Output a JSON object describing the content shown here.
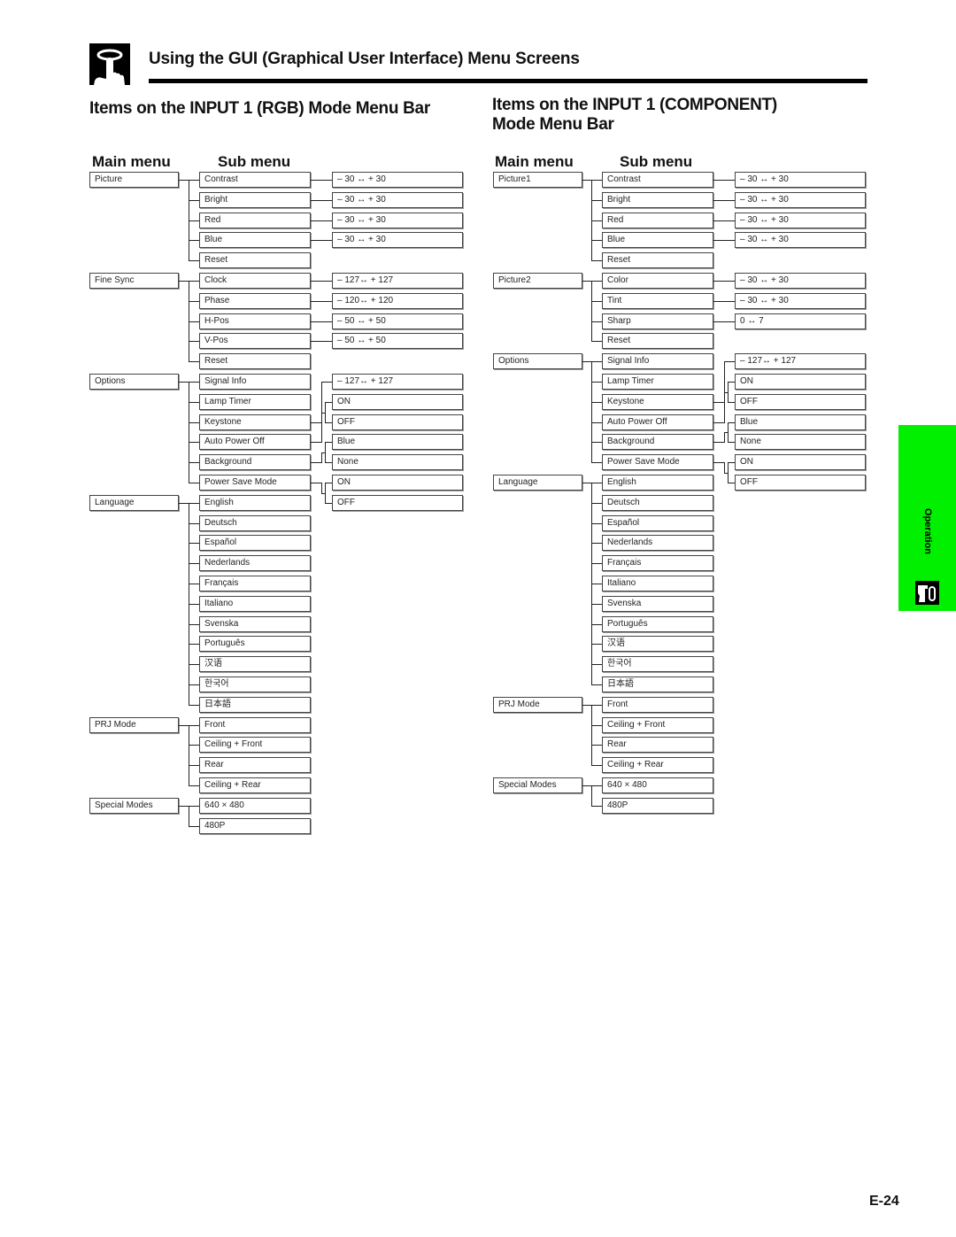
{
  "header": {
    "icon": "pointing-hand-icon",
    "title": "Using the GUI (Graphical User Interface) Menu Screens"
  },
  "rgb": {
    "heading": "Items on the INPUT 1 (RGB) Mode Menu Bar",
    "main_menu_label": "Main menu",
    "sub_menu_label": "Sub menu",
    "groups": [
      {
        "main": "Picture",
        "row": 0,
        "subs": [
          "Contrast",
          "Bright",
          "Red",
          "Blue",
          "Reset"
        ]
      },
      {
        "main": "Fine Sync",
        "row": 5,
        "subs": [
          "Clock",
          "Phase",
          "H-Pos",
          "V-Pos",
          "Reset"
        ]
      },
      {
        "main": "Options",
        "row": 10,
        "subs": [
          "Signal Info",
          "Lamp Timer",
          "Keystone",
          "Auto Power Off",
          "Background",
          "Power Save Mode"
        ]
      },
      {
        "main": "Language",
        "row": 16,
        "subs": [
          "English",
          "Deutsch",
          "Español",
          "Nederlands",
          "Français",
          "Italiano",
          "Svenska",
          "Português",
          "汉语",
          "한국어",
          "日本語"
        ]
      },
      {
        "main": "PRJ Mode",
        "row": 27,
        "subs": [
          "Front",
          "Ceiling + Front",
          "Rear",
          "Ceiling + Rear"
        ]
      },
      {
        "main": "Special Modes",
        "row": 31,
        "subs": [
          "640 × 480",
          "480P"
        ]
      }
    ],
    "values": [
      {
        "row": 0,
        "text": "– 30 ↔ + 30",
        "from_row": 0
      },
      {
        "row": 1,
        "text": "– 30 ↔ + 30",
        "from_row": 1
      },
      {
        "row": 2,
        "text": "– 30 ↔ + 30",
        "from_row": 2
      },
      {
        "row": 3,
        "text": "– 30 ↔ + 30",
        "from_row": 3
      },
      {
        "row": 5,
        "text": "– 127↔ + 127",
        "from_row": 5
      },
      {
        "row": 6,
        "text": "– 120↔ + 120",
        "from_row": 6
      },
      {
        "row": 7,
        "text": "– 50 ↔ + 50",
        "from_row": 7
      },
      {
        "row": 8,
        "text": "– 50 ↔ + 50",
        "from_row": 8
      },
      {
        "row": 10,
        "text": "– 127↔ + 127",
        "from_row": 12
      },
      {
        "row": 11,
        "text": "ON",
        "from_row": 13,
        "pair": 12
      },
      {
        "row": 12,
        "text": "OFF"
      },
      {
        "row": 13,
        "text": "Blue",
        "from_row": 14,
        "pair": 14
      },
      {
        "row": 14,
        "text": "None"
      },
      {
        "row": 15,
        "text": "ON",
        "from_row": 15,
        "pair": 16
      },
      {
        "row": 16,
        "text": "OFF"
      }
    ]
  },
  "component": {
    "heading_line1": "Items on the INPUT 1 (COMPONENT)",
    "heading_line2": "Mode Menu Bar",
    "main_menu_label": "Main menu",
    "sub_menu_label": "Sub menu",
    "groups": [
      {
        "main": "Picture1",
        "row": 0,
        "subs": [
          "Contrast",
          "Bright",
          "Red",
          "Blue",
          "Reset"
        ]
      },
      {
        "main": "Picture2",
        "row": 5,
        "subs": [
          "Color",
          "Tint",
          "Sharp",
          "Reset"
        ]
      },
      {
        "main": "Options",
        "row": 9,
        "subs": [
          "Signal Info",
          "Lamp Timer",
          "Keystone",
          "Auto Power Off",
          "Background",
          "Power Save Mode"
        ]
      },
      {
        "main": "Language",
        "row": 15,
        "subs": [
          "English",
          "Deutsch",
          "Español",
          "Nederlands",
          "Français",
          "Italiano",
          "Svenska",
          "Português",
          "汉语",
          "한국어",
          "日本語"
        ]
      },
      {
        "main": "PRJ Mode",
        "row": 26,
        "subs": [
          "Front",
          "Ceiling + Front",
          "Rear",
          "Ceiling + Rear"
        ]
      },
      {
        "main": "Special Modes",
        "row": 30,
        "subs": [
          "640 × 480",
          "480P"
        ]
      }
    ],
    "values": [
      {
        "row": 0,
        "text": "– 30 ↔ + 30",
        "from_row": 0
      },
      {
        "row": 1,
        "text": "– 30 ↔ + 30",
        "from_row": 1
      },
      {
        "row": 2,
        "text": "– 30 ↔ + 30",
        "from_row": 2
      },
      {
        "row": 3,
        "text": "– 30 ↔ + 30",
        "from_row": 3
      },
      {
        "row": 5,
        "text": "– 30 ↔ + 30",
        "from_row": 5
      },
      {
        "row": 6,
        "text": "– 30 ↔ + 30",
        "from_row": 6
      },
      {
        "row": 7,
        "text": "0 ↔ 7",
        "from_row": 7
      },
      {
        "row": 9,
        "text": "– 127↔ + 127",
        "from_row": 11
      },
      {
        "row": 10,
        "text": "ON",
        "from_row": 12,
        "pair": 11
      },
      {
        "row": 11,
        "text": "OFF"
      },
      {
        "row": 12,
        "text": "Blue",
        "from_row": 13,
        "pair": 13
      },
      {
        "row": 13,
        "text": "None"
      },
      {
        "row": 14,
        "text": "ON",
        "from_row": 14,
        "pair": 15
      },
      {
        "row": 15,
        "text": "OFF"
      }
    ]
  },
  "side_tab": {
    "label": "Operation",
    "icon": "remote-hand-icon",
    "color": "#00f000"
  },
  "page_number": "E-24"
}
